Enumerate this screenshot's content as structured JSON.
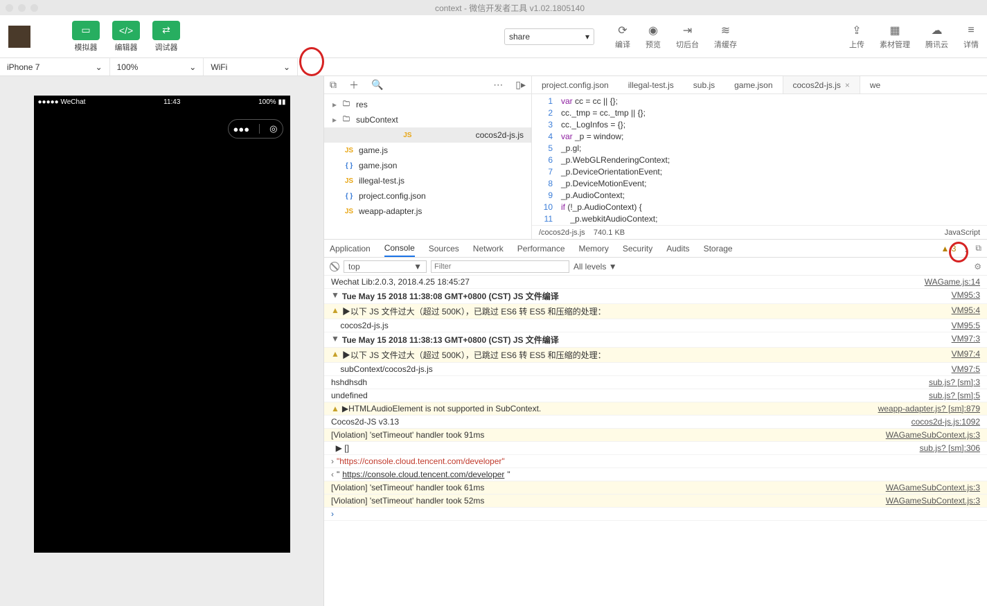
{
  "window": {
    "title": "context - 微信开发者工具 v1.02.1805140"
  },
  "toolbar": {
    "simulator": "模拟器",
    "editor": "编辑器",
    "debugger": "调试器",
    "share_select": "share",
    "compile": "编译",
    "preview": "预览",
    "background": "切后台",
    "clear_cache": "清缓存",
    "upload": "上传",
    "asset_mgmt": "素材管理",
    "tencent_cloud": "腾讯云",
    "details": "详情"
  },
  "subbar": {
    "device": "iPhone 7",
    "zoom": "100%",
    "network": "WiFi"
  },
  "file_toolbar_icons": [
    "popout",
    "plus",
    "search",
    "more",
    "dock"
  ],
  "files": [
    {
      "type": "dir",
      "name": "res"
    },
    {
      "type": "dir",
      "name": "subContext"
    },
    {
      "type": "js",
      "name": "cocos2d-js.js",
      "selected": true
    },
    {
      "type": "js",
      "name": "game.js"
    },
    {
      "type": "json",
      "name": "game.json"
    },
    {
      "type": "js",
      "name": "illegal-test.js"
    },
    {
      "type": "json",
      "name": "project.config.json"
    },
    {
      "type": "js",
      "name": "weapp-adapter.js"
    }
  ],
  "tabs": [
    "project.config.json",
    "illegal-test.js",
    "sub.js",
    "game.json",
    "cocos2d-js.js",
    "we"
  ],
  "active_tab": 4,
  "code": [
    "var cc = cc || {};",
    "cc._tmp = cc._tmp || {};",
    "cc._LogInfos = {};",
    "var _p = window;",
    "_p.gl;",
    "_p.WebGLRenderingContext;",
    "_p.DeviceOrientationEvent;",
    "_p.DeviceMotionEvent;",
    "_p.AudioContext;",
    "if (!_p.AudioContext) {",
    "    _p.webkitAudioContext;",
    "}"
  ],
  "status": {
    "path": "/cocos2d-js.js",
    "size": "740.1 KB",
    "lang": "JavaScript"
  },
  "devtools_tabs": [
    "Application",
    "Console",
    "Sources",
    "Network",
    "Performance",
    "Memory",
    "Security",
    "Audits",
    "Storage"
  ],
  "devtools_active": 1,
  "warn_count": "3",
  "filter": {
    "context": "top",
    "placeholder": "Filter",
    "levels": "All levels"
  },
  "console_rows": [
    {
      "type": "log",
      "msg": "Wechat Lib:2.0.3, 2018.4.25 18:45:27",
      "loc": "WAGame.js:14"
    },
    {
      "type": "group",
      "msg": "Tue May 15 2018 11:38:08 GMT+0800 (CST) JS 文件编译",
      "loc": "VM95:3"
    },
    {
      "type": "warn",
      "msg": "▶以下 JS 文件过大（超过 500K），已跳过 ES6 转 ES5 和压缩的处理：",
      "loc": "VM95:4"
    },
    {
      "type": "log-indent",
      "msg": "cocos2d-js.js",
      "loc": "VM95:5"
    },
    {
      "type": "group",
      "msg": "Tue May 15 2018 11:38:13 GMT+0800 (CST) JS 文件编译",
      "loc": "VM97:3"
    },
    {
      "type": "warn",
      "msg": "▶以下 JS 文件过大（超过 500K），已跳过 ES6 转 ES5 和压缩的处理：",
      "loc": "VM97:4"
    },
    {
      "type": "log-indent",
      "msg": "subContext/cocos2d-js.js",
      "loc": "VM97:5"
    },
    {
      "type": "log",
      "msg": "hshdhsdh",
      "loc": "sub.js? [sm]:3"
    },
    {
      "type": "log",
      "msg": "undefined",
      "loc": "sub.js? [sm]:5"
    },
    {
      "type": "warn",
      "msg": "▶HTMLAudioElement is not supported in SubContext.",
      "loc": "weapp-adapter.js? [sm]:879"
    },
    {
      "type": "log",
      "msg": "Cocos2d-JS v3.13",
      "loc": "cocos2d-js.js:1092"
    },
    {
      "type": "violation",
      "msg": "[Violation] 'setTimeout' handler took 91ms",
      "loc": "WAGameSubContext.js:3"
    },
    {
      "type": "expand",
      "msg": "▶ []",
      "loc": "sub.js? [sm]:306"
    },
    {
      "type": "out",
      "msg": "\"https://console.cloud.tencent.com/developer\"",
      "loc": ""
    },
    {
      "type": "in",
      "msg": "\"https://console.cloud.tencent.com/developer\"",
      "loc": ""
    },
    {
      "type": "violation",
      "msg": "[Violation] 'setTimeout' handler took 61ms",
      "loc": "WAGameSubContext.js:3"
    },
    {
      "type": "violation",
      "msg": "[Violation] 'setTimeout' handler took 52ms",
      "loc": "WAGameSubContext.js:3"
    },
    {
      "type": "prompt",
      "msg": "",
      "loc": ""
    }
  ],
  "phone": {
    "carrier": "●●●●● WeChat",
    "wifi": "📶",
    "time": "11:43",
    "battery": "100%"
  }
}
